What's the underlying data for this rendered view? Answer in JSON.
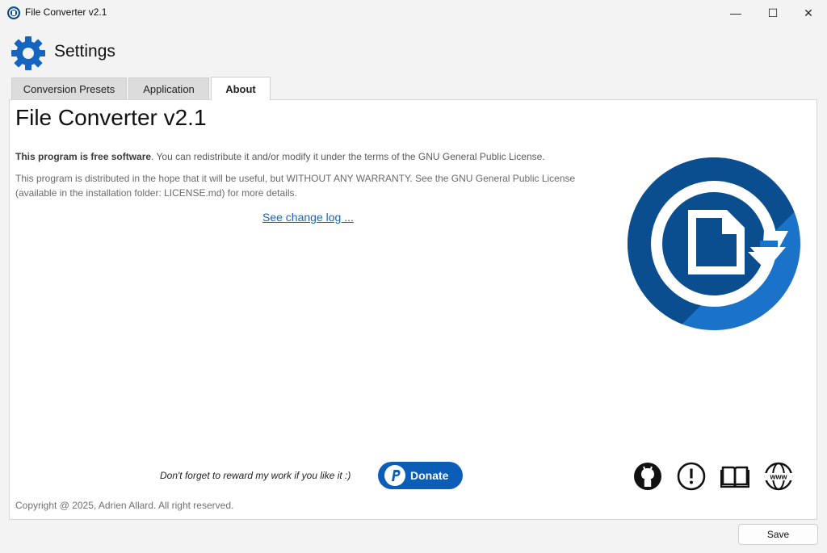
{
  "window": {
    "title": "File Converter v2.1",
    "minimize_glyph": "—",
    "maximize_glyph": "☐",
    "close_glyph": "✕"
  },
  "header": {
    "title": "Settings"
  },
  "tabs": [
    {
      "label": "Conversion Presets",
      "selected": false
    },
    {
      "label": "Application",
      "selected": false
    },
    {
      "label": "About",
      "selected": true
    }
  ],
  "about": {
    "title": "File Converter v2.1",
    "license_bold": "This program is free software",
    "license_rest": ". You can redistribute it and/or modify it under the terms of the GNU General Public License.",
    "warranty": "This program is distributed in the hope that it will be useful, but WITHOUT ANY WARRANTY. See the GNU General Public License (available in the installation folder: LICENSE.md) for more details.",
    "changelog_link": "See change log ...",
    "reward_text": "Don't forget to reward my work if you like it :)",
    "donate_label": "Donate",
    "copyright": "Copyright @ 2025, Adrien Allard. All right reserved.",
    "link_icons": [
      "github-icon",
      "issue-icon",
      "documentation-icon",
      "website-icon"
    ],
    "www_text": "www"
  },
  "footer": {
    "save_label": "Save"
  },
  "colors": {
    "accent": "#0b5db8",
    "logo_dark": "#0a4e8f",
    "logo_light": "#1a73c8",
    "link": "#1565c0"
  }
}
